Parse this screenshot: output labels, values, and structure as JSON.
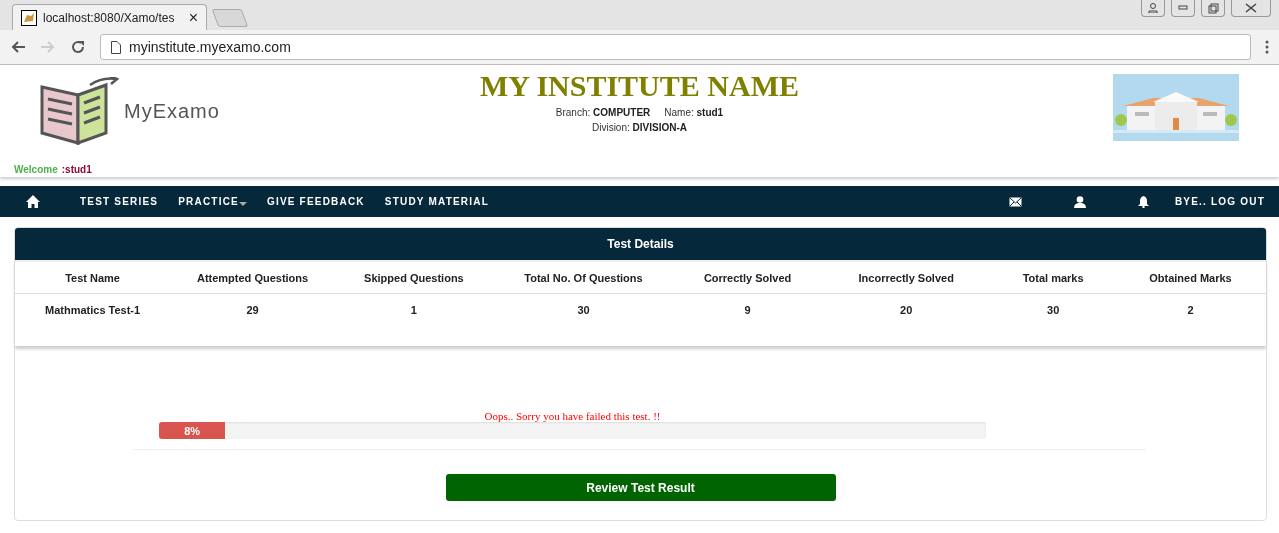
{
  "browser": {
    "tab_title": "localhost:8080/Xamo/tes",
    "tab_close": "×",
    "url": "myinstitute.myexamo.com"
  },
  "header": {
    "logo_text": "MyExamo",
    "institute": "MY INSTITUTE NAME",
    "branch_label": "Branch:",
    "branch": "COMPUTER",
    "name_label": "Name:",
    "name": "stud1",
    "division_label": "Division:",
    "division": "DIVISION-A",
    "welcome": "Welcome",
    "welcome_user": ":stud1"
  },
  "nav": {
    "items": [
      {
        "label": "TEST SERIES",
        "dropdown": false
      },
      {
        "label": "PRACTICE",
        "dropdown": true
      },
      {
        "label": "GIVE FEEDBACK",
        "dropdown": false
      },
      {
        "label": "STUDY MATERIAL",
        "dropdown": false
      }
    ],
    "logout": "BYE.. LOG OUT"
  },
  "panel": {
    "title": "Test Details",
    "columns": [
      "Test Name",
      "Attempted Questions",
      "Skipped Questions",
      "Total No. Of Questions",
      "Correctly Solved",
      "Incorrectly Solved",
      "Total marks",
      "Obtained Marks"
    ],
    "rows": [
      [
        "Mathmatics Test-1",
        "29",
        "1",
        "30",
        "9",
        "20",
        "30",
        "2"
      ]
    ]
  },
  "result": {
    "message": "Oops.. Sorry you have failed this test. !!",
    "level": 0.08,
    "reading": "8%",
    "button": "Review Test Result"
  }
}
